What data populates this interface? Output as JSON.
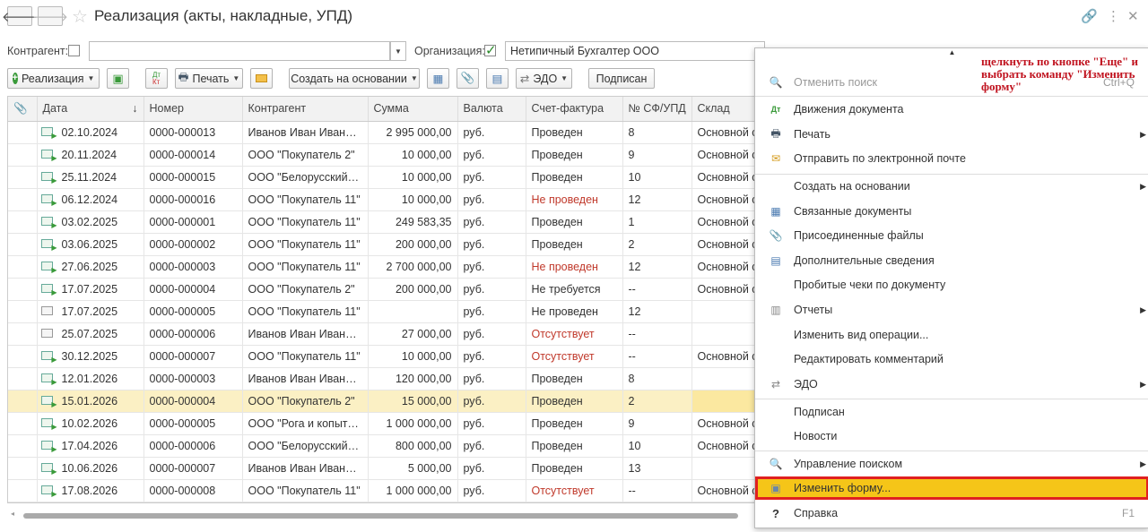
{
  "window": {
    "title": "Реализация (акты, накладные, УПД)"
  },
  "filters": {
    "counterparty_label": "Контрагент:",
    "counterparty_value": "",
    "organization_label": "Организация:",
    "organization_value": "Нетипичный Бухгалтер ООО"
  },
  "toolbar": {
    "realization": "Реализация",
    "print": "Печать",
    "create_based": "Создать на основании",
    "edo": "ЭДО",
    "signed": "Подписан"
  },
  "table": {
    "columns": [
      "Дата",
      "Номер",
      "Контрагент",
      "Сумма",
      "Валюта",
      "Счет-фактура",
      "№ СФ/УПД",
      "Склад"
    ],
    "rows": [
      {
        "status": "posted",
        "date": "02.10.2024",
        "number": "0000-000013",
        "counterparty": "Иванов Иван Иванович",
        "sum": "2 995 000,00",
        "currency": "руб.",
        "invoice": "Проведен",
        "invoice_red": false,
        "sf": "8",
        "stock": "Основной ск"
      },
      {
        "status": "posted",
        "date": "20.11.2024",
        "number": "0000-000014",
        "counterparty": "ООО \"Покупатель 2\"",
        "sum": "10 000,00",
        "currency": "руб.",
        "invoice": "Проведен",
        "invoice_red": false,
        "sf": "9",
        "stock": "Основной ск"
      },
      {
        "status": "posted",
        "date": "25.11.2024",
        "number": "0000-000015",
        "counterparty": "ООО \"Белорусский т...",
        "sum": "10 000,00",
        "currency": "руб.",
        "invoice": "Проведен",
        "invoice_red": false,
        "sf": "10",
        "stock": "Основной ск"
      },
      {
        "status": "posted",
        "date": "06.12.2024",
        "number": "0000-000016",
        "counterparty": "ООО \"Покупатель 11\"",
        "sum": "10 000,00",
        "currency": "руб.",
        "invoice": "Не проведен",
        "invoice_red": true,
        "sf": "12",
        "stock": "Основной ск"
      },
      {
        "status": "posted",
        "date": "03.02.2025",
        "number": "0000-000001",
        "counterparty": "ООО \"Покупатель 11\"",
        "sum": "249 583,35",
        "currency": "руб.",
        "invoice": "Проведен",
        "invoice_red": false,
        "sf": "1",
        "stock": "Основной ск"
      },
      {
        "status": "posted",
        "date": "03.06.2025",
        "number": "0000-000002",
        "counterparty": "ООО \"Покупатель 11\"",
        "sum": "200 000,00",
        "currency": "руб.",
        "invoice": "Проведен",
        "invoice_red": false,
        "sf": "2",
        "stock": "Основной ск"
      },
      {
        "status": "posted",
        "date": "27.06.2025",
        "number": "0000-000003",
        "counterparty": "ООО \"Покупатель 11\"",
        "sum": "2 700 000,00",
        "currency": "руб.",
        "invoice": "Не проведен",
        "invoice_red": true,
        "sf": "12",
        "stock": "Основной ск"
      },
      {
        "status": "posted",
        "date": "17.07.2025",
        "number": "0000-000004",
        "counterparty": "ООО \"Покупатель 2\"",
        "sum": "200 000,00",
        "currency": "руб.",
        "invoice": "Не требуется",
        "invoice_red": false,
        "sf": "--",
        "stock": "Основной ск"
      },
      {
        "status": "unposted",
        "date": "17.07.2025",
        "number": "0000-000005",
        "counterparty": "ООО \"Покупатель 11\"",
        "sum": "",
        "currency": "руб.",
        "invoice": "Не проведен",
        "invoice_red": false,
        "sf": "12",
        "stock": ""
      },
      {
        "status": "unposted",
        "date": "25.07.2025",
        "number": "0000-000006",
        "counterparty": "Иванов Иван Иванович",
        "sum": "27 000,00",
        "currency": "руб.",
        "invoice": "Отсутствует",
        "invoice_red": true,
        "sf": "--",
        "stock": ""
      },
      {
        "status": "posted",
        "date": "30.12.2025",
        "number": "0000-000007",
        "counterparty": "ООО \"Покупатель 11\"",
        "sum": "10 000,00",
        "currency": "руб.",
        "invoice": "Отсутствует",
        "invoice_red": true,
        "sf": "--",
        "stock": "Основной ск"
      },
      {
        "status": "posted",
        "date": "12.01.2026",
        "number": "0000-000003",
        "counterparty": "Иванов Иван Иванович",
        "sum": "120 000,00",
        "currency": "руб.",
        "invoice": "Проведен",
        "invoice_red": false,
        "sf": "8",
        "stock": ""
      },
      {
        "status": "posted",
        "date": "15.01.2026",
        "number": "0000-000004",
        "counterparty": "ООО \"Покупатель 2\"",
        "sum": "15 000,00",
        "currency": "руб.",
        "invoice": "Проведен",
        "invoice_red": false,
        "sf": "2",
        "stock": "",
        "selected": true
      },
      {
        "status": "posted",
        "date": "10.02.2026",
        "number": "0000-000005",
        "counterparty": "ООО \"Рога и копыта ...",
        "sum": "1 000 000,00",
        "currency": "руб.",
        "invoice": "Проведен",
        "invoice_red": false,
        "sf": "9",
        "stock": "Основной ск"
      },
      {
        "status": "posted",
        "date": "17.04.2026",
        "number": "0000-000006",
        "counterparty": "ООО \"Белорусский т...",
        "sum": "800 000,00",
        "currency": "руб.",
        "invoice": "Проведен",
        "invoice_red": false,
        "sf": "10",
        "stock": "Основной ск"
      },
      {
        "status": "posted",
        "date": "10.06.2026",
        "number": "0000-000007",
        "counterparty": "Иванов Иван Иванович",
        "sum": "5 000,00",
        "currency": "руб.",
        "invoice": "Проведен",
        "invoice_red": false,
        "sf": "13",
        "stock": ""
      },
      {
        "status": "posted",
        "date": "17.08.2026",
        "number": "0000-000008",
        "counterparty": "ООО \"Покупатель 11\"",
        "sum": "1 000 000,00",
        "currency": "руб.",
        "invoice": "Отсутствует",
        "invoice_red": true,
        "sf": "--",
        "stock": "Основной ск"
      }
    ]
  },
  "menu": {
    "items": [
      {
        "label": "Отменить поиск",
        "shortcut": "Ctrl+Q",
        "icon": "search-cancel-icon",
        "disabled": true
      },
      {
        "label": "Движения документа",
        "icon": "dt-kt-icon"
      },
      {
        "label": "Печать",
        "icon": "printer-icon",
        "submenu": true
      },
      {
        "label": "Отправить по электронной почте",
        "icon": "envelope-icon"
      },
      {
        "label": "Создать на основании",
        "submenu": true
      },
      {
        "label": "Связанные документы",
        "icon": "linked-docs-icon"
      },
      {
        "label": "Присоединенные файлы",
        "icon": "paperclip-icon"
      },
      {
        "label": "Дополнительные сведения",
        "icon": "info-doc-icon"
      },
      {
        "label": "Пробитые чеки по документу"
      },
      {
        "label": "Отчеты",
        "icon": "reports-icon",
        "submenu": true
      },
      {
        "label": "Изменить вид операции..."
      },
      {
        "label": "Редактировать комментарий"
      },
      {
        "label": "ЭДО",
        "icon": "edo-icon",
        "submenu": true
      },
      {
        "label": "Подписан"
      },
      {
        "label": "Новости"
      },
      {
        "label": "Управление поиском",
        "icon": "magnifier-icon",
        "submenu": true
      },
      {
        "label": "Изменить форму...",
        "icon": "form-settings-icon",
        "highlighted": true
      },
      {
        "label": "Справка",
        "shortcut": "F1",
        "icon": "help-icon"
      }
    ]
  },
  "annotation": "щелкнуть по кнопке \"Еще\" и выбрать команду \"Изменить форму\"",
  "colors": {
    "highlight": "#f5c518",
    "annotation_border": "#e02020",
    "selected_row": "#fbf0c4",
    "accent_green": "#3a9a3a"
  }
}
